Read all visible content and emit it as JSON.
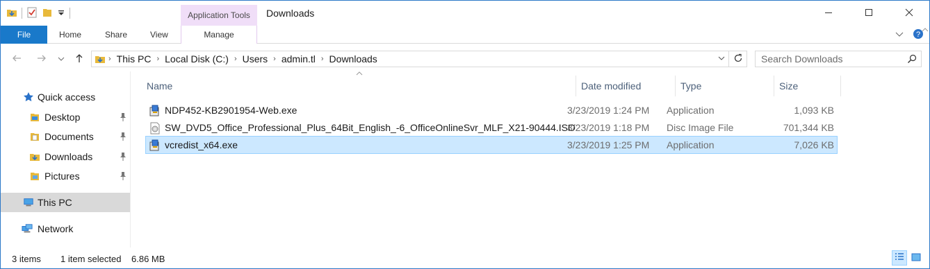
{
  "window": {
    "title": "Downloads",
    "context_tab_group": "Application Tools"
  },
  "ribbon": {
    "file_label": "File",
    "tabs": [
      "Home",
      "Share",
      "View"
    ],
    "context_tab": "Manage"
  },
  "address": {
    "crumbs": [
      "This PC",
      "Local Disk (C:)",
      "Users",
      "admin.tl",
      "Downloads"
    ]
  },
  "search": {
    "placeholder": "Search Downloads"
  },
  "navpane": {
    "quick_access": "Quick access",
    "quick_items": [
      {
        "label": "Desktop",
        "icon": "desktop-folder-icon"
      },
      {
        "label": "Documents",
        "icon": "documents-folder-icon"
      },
      {
        "label": "Downloads",
        "icon": "downloads-folder-icon"
      },
      {
        "label": "Pictures",
        "icon": "pictures-folder-icon"
      }
    ],
    "this_pc": "This PC",
    "network": "Network"
  },
  "filelist": {
    "columns": [
      "Name",
      "Date modified",
      "Type",
      "Size"
    ],
    "rows": [
      {
        "name": "NDP452-KB2901954-Web.exe",
        "date": "3/23/2019 1:24 PM",
        "type": "Application",
        "size": "1,093 KB",
        "icon": "installer-exe-icon",
        "selected": false
      },
      {
        "name": "SW_DVD5_Office_Professional_Plus_64Bit_English_-6_OfficeOnlineSvr_MLF_X21-90444.ISO",
        "date": "3/23/2019 1:18 PM",
        "type": "Disc Image File",
        "size": "701,344 KB",
        "icon": "disc-image-icon",
        "selected": false
      },
      {
        "name": "vcredist_x64.exe",
        "date": "3/23/2019 1:25 PM",
        "type": "Application",
        "size": "7,026 KB",
        "icon": "installer-exe-icon",
        "selected": true
      }
    ]
  },
  "status": {
    "item_count": "3 items",
    "selection": "1 item selected",
    "selection_size": "6.86 MB"
  },
  "colors": {
    "accent": "#1979ca",
    "selection_bg": "#cce8ff",
    "selection_border": "#99d1ff",
    "context_tab": "#f0def8"
  }
}
